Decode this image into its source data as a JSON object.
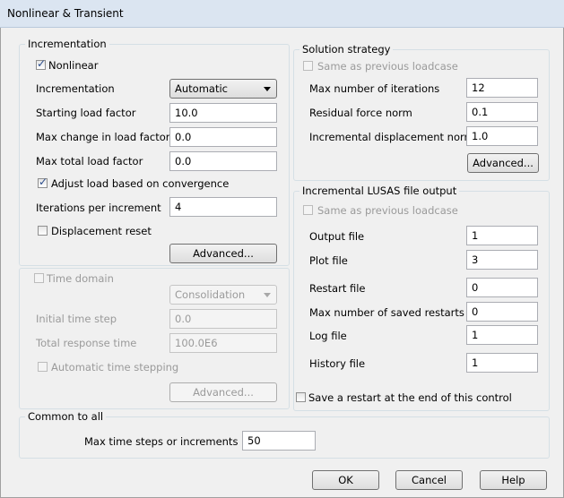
{
  "window": {
    "title": "Nonlinear & Transient"
  },
  "incrementation": {
    "group_title": "Incrementation",
    "nonlinear_label": "Nonlinear",
    "nonlinear_checked": true,
    "incrementation_label": "Incrementation",
    "incrementation_value": "Automatic",
    "starting_load_factor_label": "Starting load factor",
    "starting_load_factor": "10.0",
    "max_change_label": "Max change in load factor",
    "max_change": "0.0",
    "max_total_label": "Max total load factor",
    "max_total": "0.0",
    "adjust_label": "Adjust load based on convergence",
    "adjust_checked": true,
    "iterations_label": "Iterations per increment",
    "iterations": "4",
    "displacement_reset_label": "Displacement reset",
    "displacement_reset_checked": false,
    "advanced_label": "Advanced..."
  },
  "time_domain": {
    "label": "Time domain",
    "type_value": "Consolidation",
    "initial_time_step_label": "Initial time step",
    "initial_time_step": "0.0",
    "total_response_time_label": "Total response time",
    "total_response_time": "100.0E6",
    "automatic_time_stepping_label": "Automatic time stepping",
    "advanced_label": "Advanced..."
  },
  "solution_strategy": {
    "group_title": "Solution strategy",
    "same_as_previous_label": "Same as previous loadcase",
    "max_iterations_label": "Max number of iterations",
    "max_iterations": "12",
    "residual_force_label": "Residual force norm",
    "residual_force": "0.1",
    "incremental_disp_label": "Incremental displacement norm",
    "incremental_disp": "1.0",
    "advanced_label": "Advanced..."
  },
  "lusas_output": {
    "group_title": "Incremental LUSAS file output",
    "same_as_previous_label": "Same as previous loadcase",
    "output_file_label": "Output file",
    "output_file": "1",
    "plot_file_label": "Plot file",
    "plot_file": "3",
    "restart_file_label": "Restart file",
    "restart_file": "0",
    "max_restarts_label": "Max number of saved restarts",
    "max_restarts": "0",
    "log_file_label": "Log file",
    "log_file": "1",
    "history_file_label": "History file",
    "history_file": "1"
  },
  "save_restart": {
    "label": "Save a restart at the end of this control",
    "checked": false
  },
  "common": {
    "group_title": "Common to all",
    "max_steps_label": "Max time steps or increments",
    "max_steps": "50"
  },
  "buttons": {
    "ok": "OK",
    "cancel": "Cancel",
    "help": "Help"
  }
}
